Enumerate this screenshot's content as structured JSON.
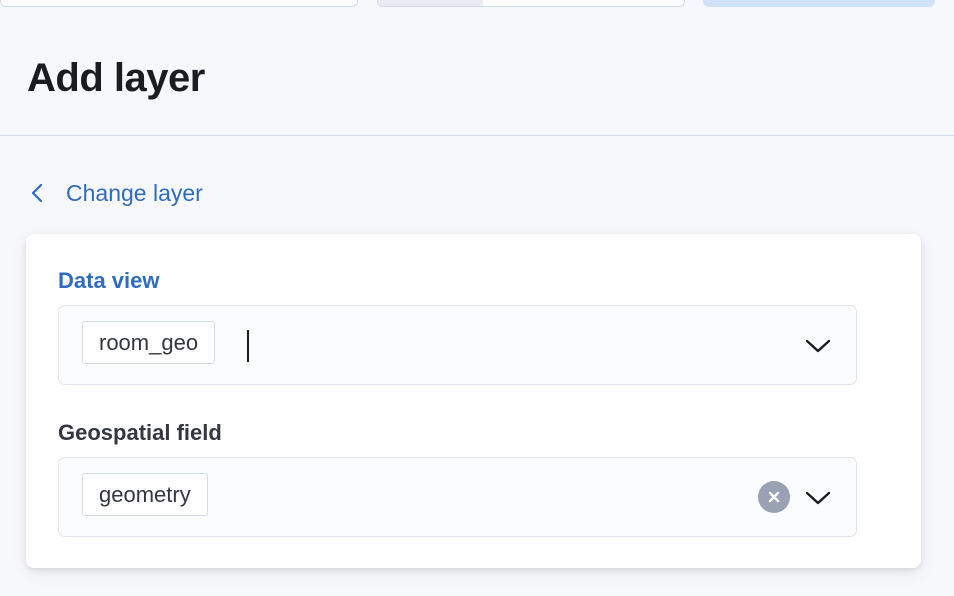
{
  "header": {
    "title": "Add layer"
  },
  "nav": {
    "back_label": "Change layer"
  },
  "form": {
    "data_view": {
      "label": "Data view",
      "selected": "room_geo"
    },
    "geospatial_field": {
      "label": "Geospatial field",
      "selected": "geometry"
    }
  },
  "icons": {
    "back": "chevron-left-icon",
    "dropdown": "chevron-down-icon",
    "clear": "clear-icon"
  },
  "colors": {
    "accent": "#2f6cbf",
    "background": "#f7f8fc",
    "panel": "#ffffff",
    "clear_button": "#98a2b3"
  }
}
